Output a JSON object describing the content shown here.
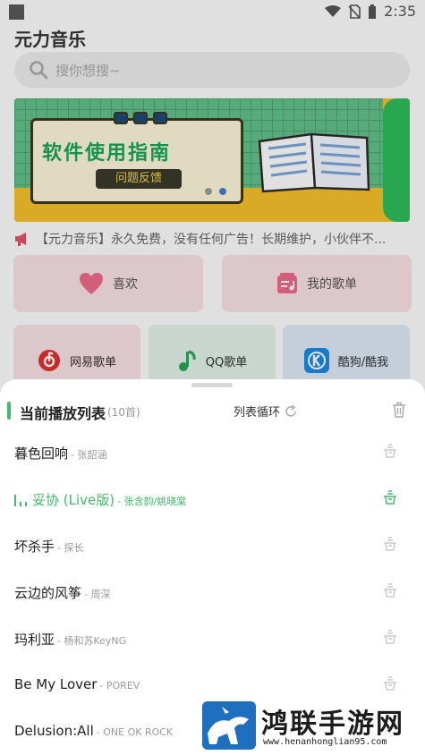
{
  "status_bar": {
    "time": "2:35"
  },
  "app": {
    "title": "元力音乐"
  },
  "search": {
    "placeholder": "搜你想搜~"
  },
  "banner": {
    "headline": "软件使用指南",
    "tag": "问题反馈",
    "active_slide": 2,
    "slide_count": 2
  },
  "notice": {
    "text": "【元力音乐】永久免费，没有任何广告！长期维护，小伙伴不..."
  },
  "quick_actions": [
    {
      "label": "喜欢",
      "icon": "heart-icon"
    },
    {
      "label": "我的歌单",
      "icon": "playlist-icon"
    }
  ],
  "sources": [
    {
      "label": "网易歌单",
      "icon": "netease-icon",
      "bg": "#fbe3e6"
    },
    {
      "label": "QQ歌单",
      "icon": "qq-music-icon",
      "bg": "#e4f4ea"
    },
    {
      "label": "酷狗/酷我",
      "icon": "kugou-icon",
      "bg": "#e2ecf8"
    }
  ],
  "playlist": {
    "title": "当前播放列表",
    "count": "(10首)",
    "mode": "列表循环",
    "songs": [
      {
        "name": "暮色回响",
        "artist": "- 张韶涵",
        "active": false
      },
      {
        "name": "妥协 (Live版)",
        "artist": "- 张含韵/姚晓棠",
        "active": true
      },
      {
        "name": "坏杀手",
        "artist": "- 探长",
        "active": false
      },
      {
        "name": "云边的风筝",
        "artist": "- 周深",
        "active": false
      },
      {
        "name": "玛利亚",
        "artist": "- 杨和苏KeyNG",
        "active": false
      },
      {
        "name": "Be My Lover",
        "artist": "- POREV",
        "active": false
      },
      {
        "name": "Delusion:All",
        "artist": "- ONE OK ROCK",
        "active": false
      }
    ]
  },
  "watermark": {
    "name": "鸿联手游网",
    "url": "www.henanhonglian95.com"
  },
  "colors": {
    "accent": "#46b86a",
    "pink": "#fbe3e6",
    "blue": "#1f6fc1"
  }
}
